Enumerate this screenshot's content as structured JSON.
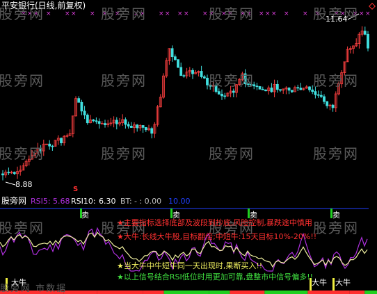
{
  "colors": {
    "up": "#ff4040",
    "down": "#40e0e0",
    "purple": "#b030e0",
    "yellow": "#f0f0a0",
    "white": "#ffffff",
    "green": "#20d020",
    "red": "#ff3030",
    "blue": "#2040ff",
    "marker": "#e040e0"
  },
  "header": {
    "title": "平安银行(日线,前复权)"
  },
  "price": {
    "high_label": "11.64",
    "low_label": "8.88"
  },
  "indicator": {
    "site": "股旁网",
    "rsi5_label": "RSI5:",
    "rsi5_value": "5.68",
    "rsi10_label": "RSI10:",
    "rsi10_value": "6.30",
    "bt_label": "BT:",
    "bt_value": "- : 0.00",
    "blue_value": "10.00",
    "sell_marker": "S",
    "notes": [
      "★主要指标选择底部及波段到抄底,风险控制,暴跌途中慎用",
      "★大牛:长线大牛股,目标翻倍;中短牛:15天目标10%-20%!!",
      "★当大牛中牛短牛同一天出现时,果断买入!!",
      "★以上信号结合RSI低位时用更加可靠,盘整市中信号偏多!!"
    ],
    "signal_labels": [
      "卖",
      "卖",
      "卖",
      "卖"
    ],
    "bottom_labels": [
      "大牛",
      "大牛",
      "大牛"
    ]
  },
  "watermark": {
    "text": "股旁网",
    "bottom_text": "股旁网 市数据"
  }
}
